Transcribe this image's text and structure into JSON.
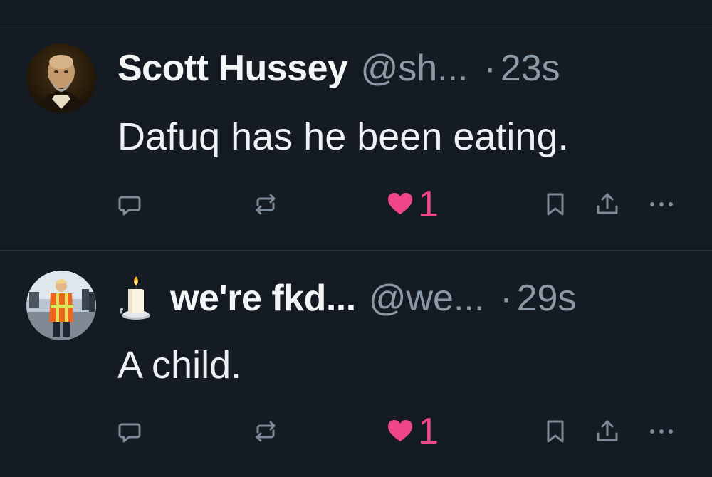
{
  "tweets": [
    {
      "display_name": "Scott Hussey",
      "handle": "@sh...",
      "separator": "·",
      "time": "23s",
      "text": "Dafuq has he been eating.",
      "like_count": "1",
      "avatar_icon": "painted-portrait-avatar"
    },
    {
      "display_name": "we're fkd...",
      "name_emoji": "candle-emoji",
      "handle": "@we...",
      "separator": "·",
      "time": "29s",
      "text": "A child.",
      "like_count": "1",
      "avatar_icon": "photo-avatar-safety-vest"
    }
  ],
  "colors": {
    "background": "#151b23",
    "text": "#eef1f4",
    "muted": "#8b98a5",
    "icon": "#7d8a98",
    "like": "#f0458a",
    "divider": "#2c333c"
  }
}
